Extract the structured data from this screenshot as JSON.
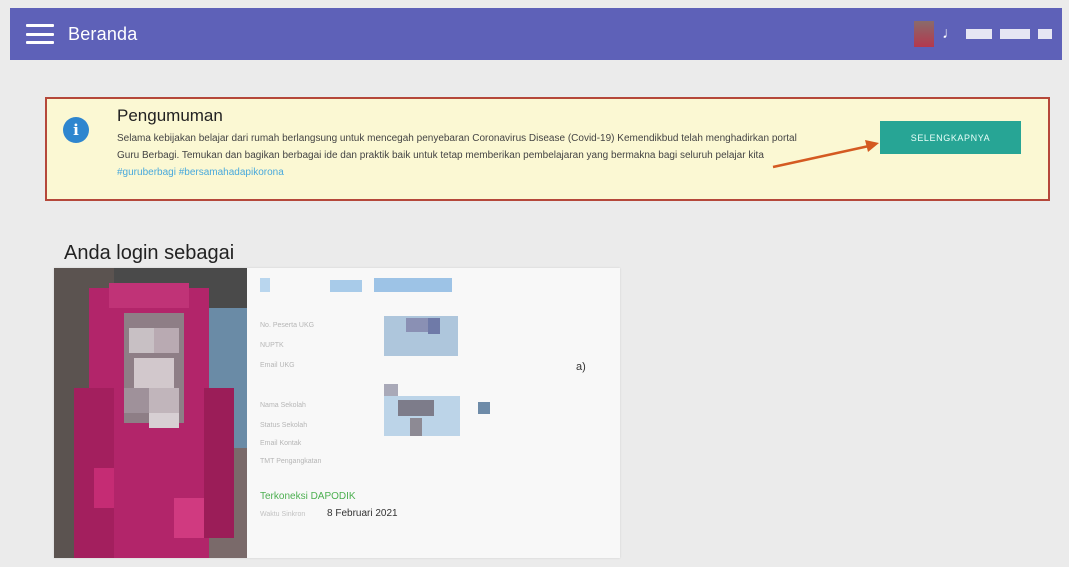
{
  "header": {
    "title": "Beranda",
    "note_glyph": "♩"
  },
  "announcement": {
    "title": "Pengumuman",
    "body": "Selama kebijakan belajar dari rumah berlangsung untuk mencegah penyebaran Coronavirus Disease (Covid-19) Kemendikbud telah menghadirkan portal Guru Berbagi. Temukan dan bagikan berbagai ide dan praktik baik untuk tetap memberikan pembelajaran yang bermakna bagi seluruh pelajar kita",
    "tags": "#guruberbagi #bersamahadapikorona",
    "button_label": "SELENGKAPNYA"
  },
  "login": {
    "heading": "Anda login sebagai",
    "fields": {
      "no_peserta": "No. Peserta UKG",
      "nuptk": "NUPTK",
      "email_ukg": "Email UKG",
      "nama_sekolah": "Nama Sekolah",
      "status_sekolah": "Status Sekolah",
      "email_kontak": "Email Kontak",
      "tmt": "TMT Pengangkatan"
    },
    "stray_text": "a)",
    "dapodik_status": "Terkoneksi DAPODIK",
    "sync_label": "Waktu Sinkron",
    "sync_date": "8 Februari 2021"
  },
  "colors": {
    "header_bg": "#5e61b8",
    "announcement_bg": "#fbf8d3",
    "announcement_border": "#b5483a",
    "button_bg": "#27a595",
    "info_icon": "#2e86cf",
    "dapodik": "#4caf50"
  }
}
